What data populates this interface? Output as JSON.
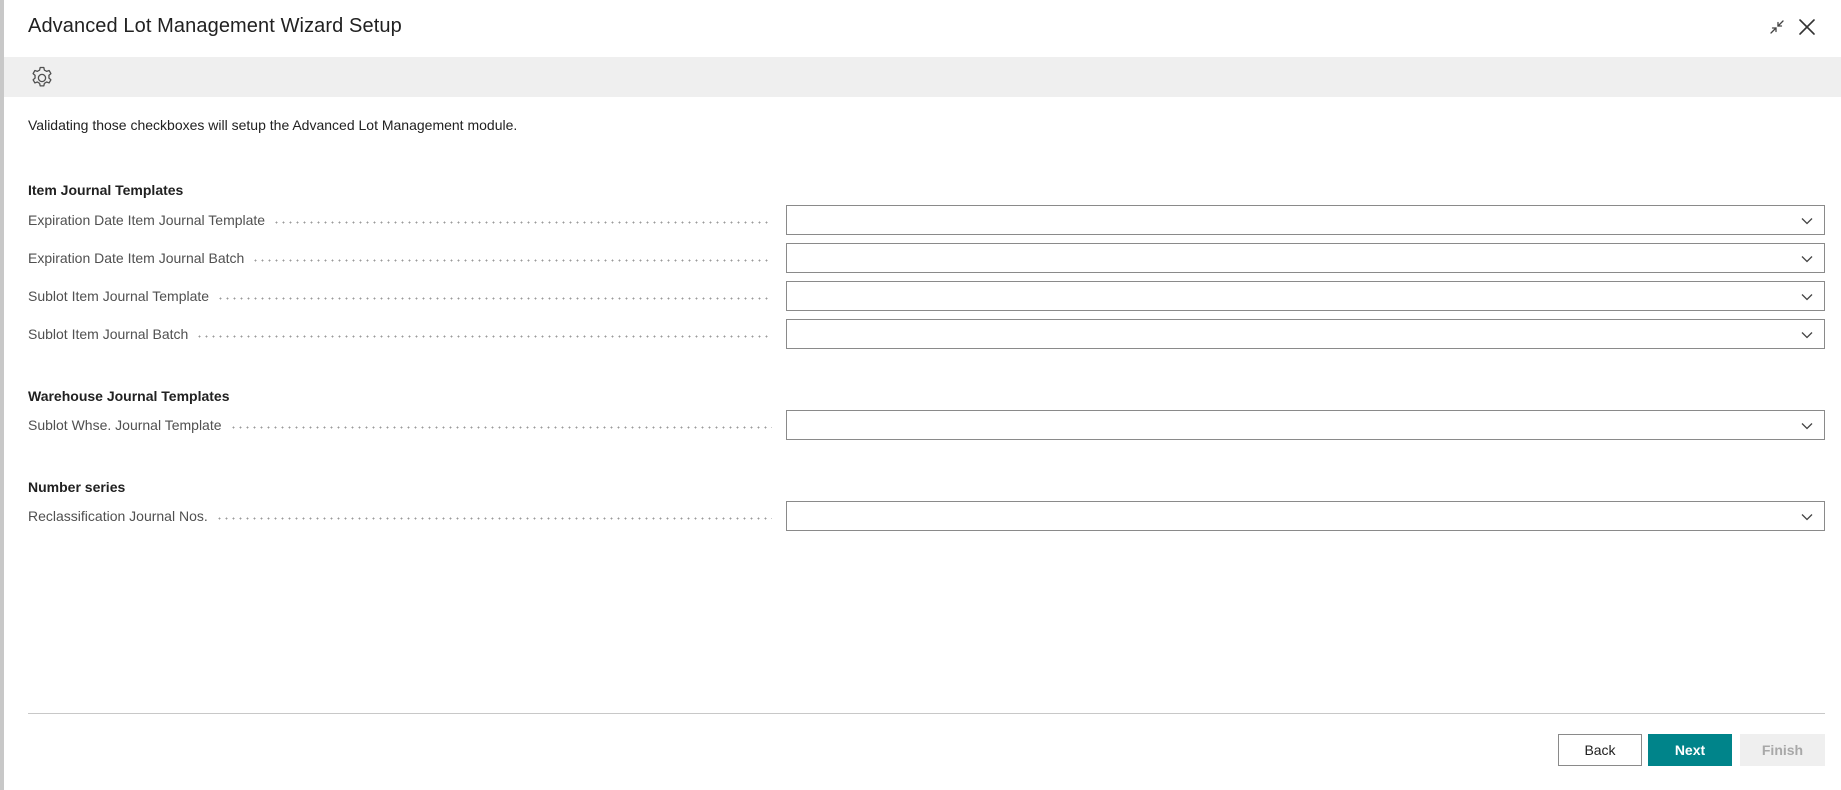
{
  "window": {
    "title": "Advanced Lot Management Wizard Setup"
  },
  "instruction": "Validating those checkboxes will setup the Advanced Lot Management module.",
  "groups": [
    {
      "title": "Item Journal Templates",
      "fields": [
        {
          "label": "Expiration Date Item Journal Template",
          "value": ""
        },
        {
          "label": "Expiration Date Item Journal Batch",
          "value": ""
        },
        {
          "label": "Sublot Item Journal Template",
          "value": ""
        },
        {
          "label": "Sublot Item Journal Batch",
          "value": ""
        }
      ]
    },
    {
      "title": "Warehouse Journal Templates",
      "fields": [
        {
          "label": "Sublot Whse. Journal Template",
          "value": ""
        }
      ]
    },
    {
      "title": "Number series",
      "fields": [
        {
          "label": "Reclassification Journal Nos.",
          "value": ""
        }
      ]
    }
  ],
  "buttons": {
    "back": "Back",
    "next": "Next",
    "finish": "Finish"
  },
  "icons": {
    "toolbar": "gear-icon",
    "collapse": "collapse-icon",
    "close": "close-icon",
    "dropdown": "chevron-down-icon"
  },
  "colors": {
    "accent": "#00848a",
    "toolbar_bg": "#efefef",
    "disabled_text": "#a8a8a8"
  }
}
